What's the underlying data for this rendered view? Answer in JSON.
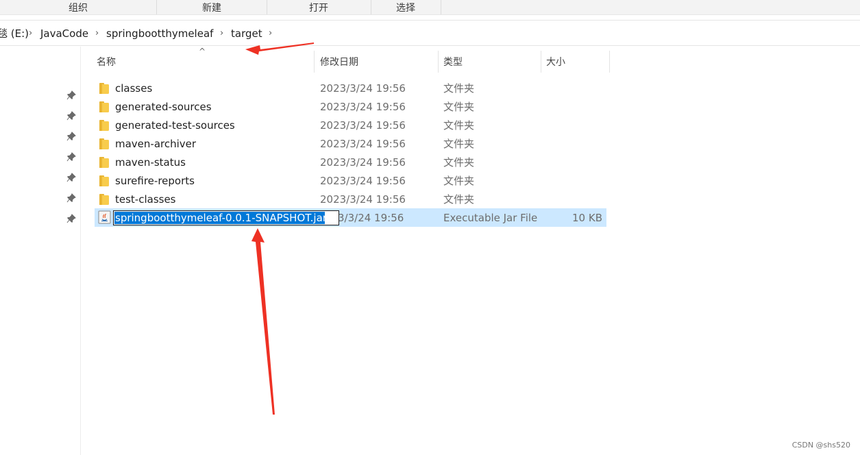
{
  "ribbon": {
    "groups": [
      "组织",
      "新建",
      "打开",
      "选择"
    ]
  },
  "address": {
    "crumbs": [
      "E:)",
      "JavaCode",
      "springbootthymeleaf",
      "target"
    ],
    "drive_prefix": "毯 (E:)"
  },
  "columns": {
    "name": "名称",
    "modified": "修改日期",
    "type": "类型",
    "size": "大小"
  },
  "files": [
    {
      "name": "classes",
      "modified": "2023/3/24 19:56",
      "type": "文件夹",
      "size": "",
      "icon": "folder-icon"
    },
    {
      "name": "generated-sources",
      "modified": "2023/3/24 19:56",
      "type": "文件夹",
      "size": "",
      "icon": "folder-icon"
    },
    {
      "name": "generated-test-sources",
      "modified": "2023/3/24 19:56",
      "type": "文件夹",
      "size": "",
      "icon": "folder-icon"
    },
    {
      "name": "maven-archiver",
      "modified": "2023/3/24 19:56",
      "type": "文件夹",
      "size": "",
      "icon": "folder-icon"
    },
    {
      "name": "maven-status",
      "modified": "2023/3/24 19:56",
      "type": "文件夹",
      "size": "",
      "icon": "folder-icon"
    },
    {
      "name": "surefire-reports",
      "modified": "2023/3/24 19:56",
      "type": "文件夹",
      "size": "",
      "icon": "folder-icon"
    },
    {
      "name": "test-classes",
      "modified": "2023/3/24 19:56",
      "type": "文件夹",
      "size": "",
      "icon": "folder-icon"
    }
  ],
  "selected_file": {
    "name": "springbootthymeleaf-0.0.1-SNAPSHOT.jar",
    "modified_partial": "3/3/24 19:56",
    "type": "Executable Jar File",
    "size": "10 KB",
    "icon": "java-jar-icon"
  },
  "colors": {
    "selection_bg": "#cce8ff",
    "rename_highlight": "#0078d7",
    "annotation_arrow": "#ee3124"
  },
  "watermark": "CSDN @shs520"
}
